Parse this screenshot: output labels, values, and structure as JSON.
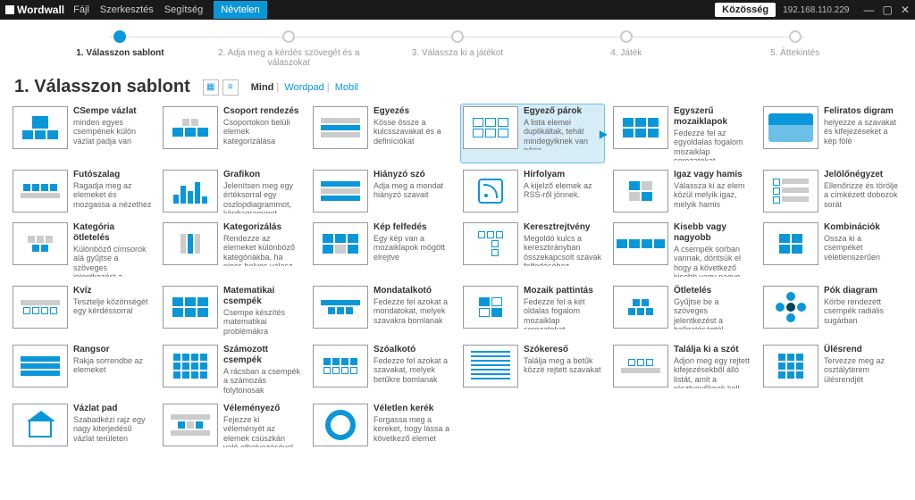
{
  "app": {
    "logo_text": "Wordwall",
    "menu": [
      "Fájl",
      "Szerkesztés",
      "Segítség"
    ],
    "doc_name": "Névtelen",
    "community_btn": "Közösség",
    "ip": "192.168.110.229"
  },
  "stepper": {
    "steps": [
      "1. Válasszon sablont",
      "2. Adja meg a kérdés szövegét és a válaszokat",
      "3. Válassza ki a játékot",
      "4. Játék",
      "5. Áttekintés"
    ],
    "active_index": 0
  },
  "header": {
    "title": "1.   Válasszon sablont",
    "filters": [
      "Mind",
      "Wordpad",
      "Mobil"
    ],
    "active_filter": 0
  },
  "templates": [
    {
      "title": "CSempe vázlat",
      "desc": "minden egyes csempének külön vázlat padja van",
      "thumb": "tiles"
    },
    {
      "title": "Csoport rendezés",
      "desc": "Csoportokon belüli elemek kategorizálása",
      "thumb": "groups"
    },
    {
      "title": "Egyezés",
      "desc": "Kösse össze a kulcsszavakat és a definíciókat",
      "thumb": "match"
    },
    {
      "title": "Egyező párok",
      "desc": "A lista elemei duplikáltak, tehát mindegyiknek van párja",
      "thumb": "pairs",
      "highlight": true
    },
    {
      "title": "Egyszerű mozaiklapok",
      "desc": "Fedezze fel az egyoldalas fogalom mozaiklap sorozatokat",
      "thumb": "simpletiles"
    },
    {
      "title": "Feliratos digram",
      "desc": "helyezze a szavakat és kifejezéseket a kép fölé",
      "thumb": "map"
    },
    {
      "title": "Futószalag",
      "desc": "Ragadja meg az elemeket és mozgassa a nézethez",
      "thumb": "conveyor"
    },
    {
      "title": "Grafikon",
      "desc": "Jelenítsen meg egy értéksorral egy oszlopdiagrammot, kördiagrammot,...",
      "thumb": "chart"
    },
    {
      "title": "Hiányzó szó",
      "desc": "Adja meg a mondat hiányzó szavait",
      "thumb": "missing"
    },
    {
      "title": "Hírfolyam",
      "desc": "A kijelző elemek az RSS-ről jönnek.",
      "thumb": "rss"
    },
    {
      "title": "Igaz vagy hamis",
      "desc": "Válassza ki az elem közül melyik igaz, melyik hamis",
      "thumb": "truefalse"
    },
    {
      "title": "Jelölőnégyzet",
      "desc": "Ellenőrizze és törölje a címkézett dobozok sorát",
      "thumb": "checkbox"
    },
    {
      "title": "Kategória ötletelés",
      "desc": "Különböző címsorok alá gyűjtse a szöveges jelentkezést a hallgatóságtól!",
      "thumb": "catbrain"
    },
    {
      "title": "Kategorizálás",
      "desc": "Rendezze az elemeket különböző kategóriákba, ha nincs helyes válasz",
      "thumb": "categorize"
    },
    {
      "title": "Kép felfedés",
      "desc": "Egy kép van a mozaiklapok mögött elrejtve",
      "thumb": "reveal"
    },
    {
      "title": "Keresztrejtvény",
      "desc": "Megoldó kulcs a keresztirányban összekapcsolt szavak felfedéséhez",
      "thumb": "crossword"
    },
    {
      "title": "Kisebb vagy nagyobb",
      "desc": "A csempék sorban vannak, döntsük el hogy a következő kisebb vagy nagyo...",
      "thumb": "higher"
    },
    {
      "title": "Kombinációk",
      "desc": "Ossza ki a csempéket véletlenszerűen",
      "thumb": "combos"
    },
    {
      "title": "Kvíz",
      "desc": "Tesztelje közönségét egy kérdéssorral",
      "thumb": "quiz"
    },
    {
      "title": "Matematikai csempék",
      "desc": "Csempe készítés matematikai problémákra",
      "thumb": "math"
    },
    {
      "title": "Mondatalkotó",
      "desc": "Fedezze fel azokat a mondatokat, melyek szavakra bomlanak",
      "thumb": "sentence"
    },
    {
      "title": "Mozaik pattintás",
      "desc": "Fedezze fel a két oldalas fogalom mozaiklap sorozatokat",
      "thumb": "flip"
    },
    {
      "title": "Ötletelés",
      "desc": "Gyűjtse be a szöveges jelentkezést a hallgatóságtól.",
      "thumb": "brain"
    },
    {
      "title": "Pók diagram",
      "desc": "Körbe rendezett csempék radiális sugárban",
      "thumb": "spider"
    },
    {
      "title": "Rangsor",
      "desc": "Rakja sorrendbe az elemeket",
      "thumb": "rank"
    },
    {
      "title": "Számozott csempék",
      "desc": "A rácsban a csempék a számozás folytonosak",
      "thumb": "numbered"
    },
    {
      "title": "Szóalkotó",
      "desc": "Fedezze fel azokat a szavakat, melyek betűkre bomlanak",
      "thumb": "word"
    },
    {
      "title": "Szókereső",
      "desc": "Találja meg a betűk közzé rejtett szavakat",
      "thumb": "wordsearch"
    },
    {
      "title": "Találja ki a szót",
      "desc": "Adjon meg egy rejtett kifejezésekből álló listát, amit a résztvevőknek kell...",
      "thumb": "guess"
    },
    {
      "title": "Ülésrend",
      "desc": "Tervezze meg az osztályterem ülésrendjét",
      "thumb": "seating"
    },
    {
      "title": "Vázlat pad",
      "desc": "Szabadkézi rajz egy nagy kiterjedésű vázlat területen",
      "thumb": "sketch"
    },
    {
      "title": "Véleményező",
      "desc": "Fejezze ki véleményét az elemek csúszkán való elhelyezésével",
      "thumb": "opinion"
    },
    {
      "title": "Véletlen kerék",
      "desc": "Forgassa meg a kereket, hogy lássa a következő elemet",
      "thumb": "wheel"
    }
  ]
}
